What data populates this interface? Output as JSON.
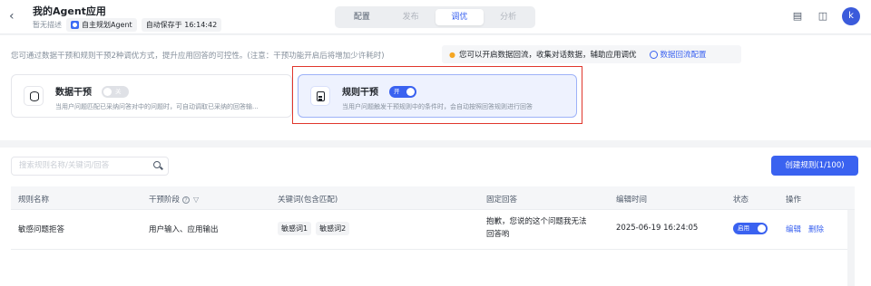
{
  "header": {
    "back_icon": "chevron-left-icon",
    "title": "我的Agent应用",
    "no_desc": "暂无描述",
    "agent_chip": "自主规划Agent",
    "autosave": "自动保存于 16:14:42",
    "tabs": [
      {
        "label": "配置",
        "state": "normal"
      },
      {
        "label": "发布",
        "state": "disabled"
      },
      {
        "label": "调优",
        "state": "active"
      },
      {
        "label": "分析",
        "state": "disabled"
      }
    ],
    "icons": [
      "book-icon",
      "chat-icon"
    ],
    "avatar": "k"
  },
  "intervention": {
    "description": "您可通过数据干预和规则干预2种调优方式，提升应用回答的可控性。(注意：干预功能开启后将增加少许耗时)",
    "tip": "您可以开启数据回流，收集对话数据，辅助应用调优",
    "tip_link": "数据回流配置",
    "cards": [
      {
        "title": "数据干预",
        "toggle": "关",
        "enabled": false,
        "desc": "当用户问题匹配已采纳问答对中的问题时，可自动调取已采纳的回答输..."
      },
      {
        "title": "规则干预",
        "toggle": "开",
        "enabled": true,
        "desc": "当用户问题触发干预规则中的条件时，会自动按照回答规则进行回答"
      }
    ]
  },
  "rules": {
    "search_placeholder": "搜索规则名称/关键词/回答",
    "create_button": "创建规则(1/100)",
    "columns": [
      "规则名称",
      "干预阶段",
      "关键词(包含匹配)",
      "固定回答",
      "编辑时间",
      "状态",
      "操作"
    ],
    "row": {
      "name": "敏感问题拒答",
      "stage": "用户输入、应用输出",
      "keywords": [
        "敏感词1",
        "敏感词2"
      ],
      "answer_line1": "抱歉，您说的这个问题我无法",
      "answer_line2": "回答哟",
      "edited": "2025-06-19 16:24:05",
      "status": "启用",
      "actions": [
        "编辑",
        "删除"
      ]
    }
  },
  "colors": {
    "accent": "#3a62f0",
    "highlight_frame": "#e0362c"
  }
}
